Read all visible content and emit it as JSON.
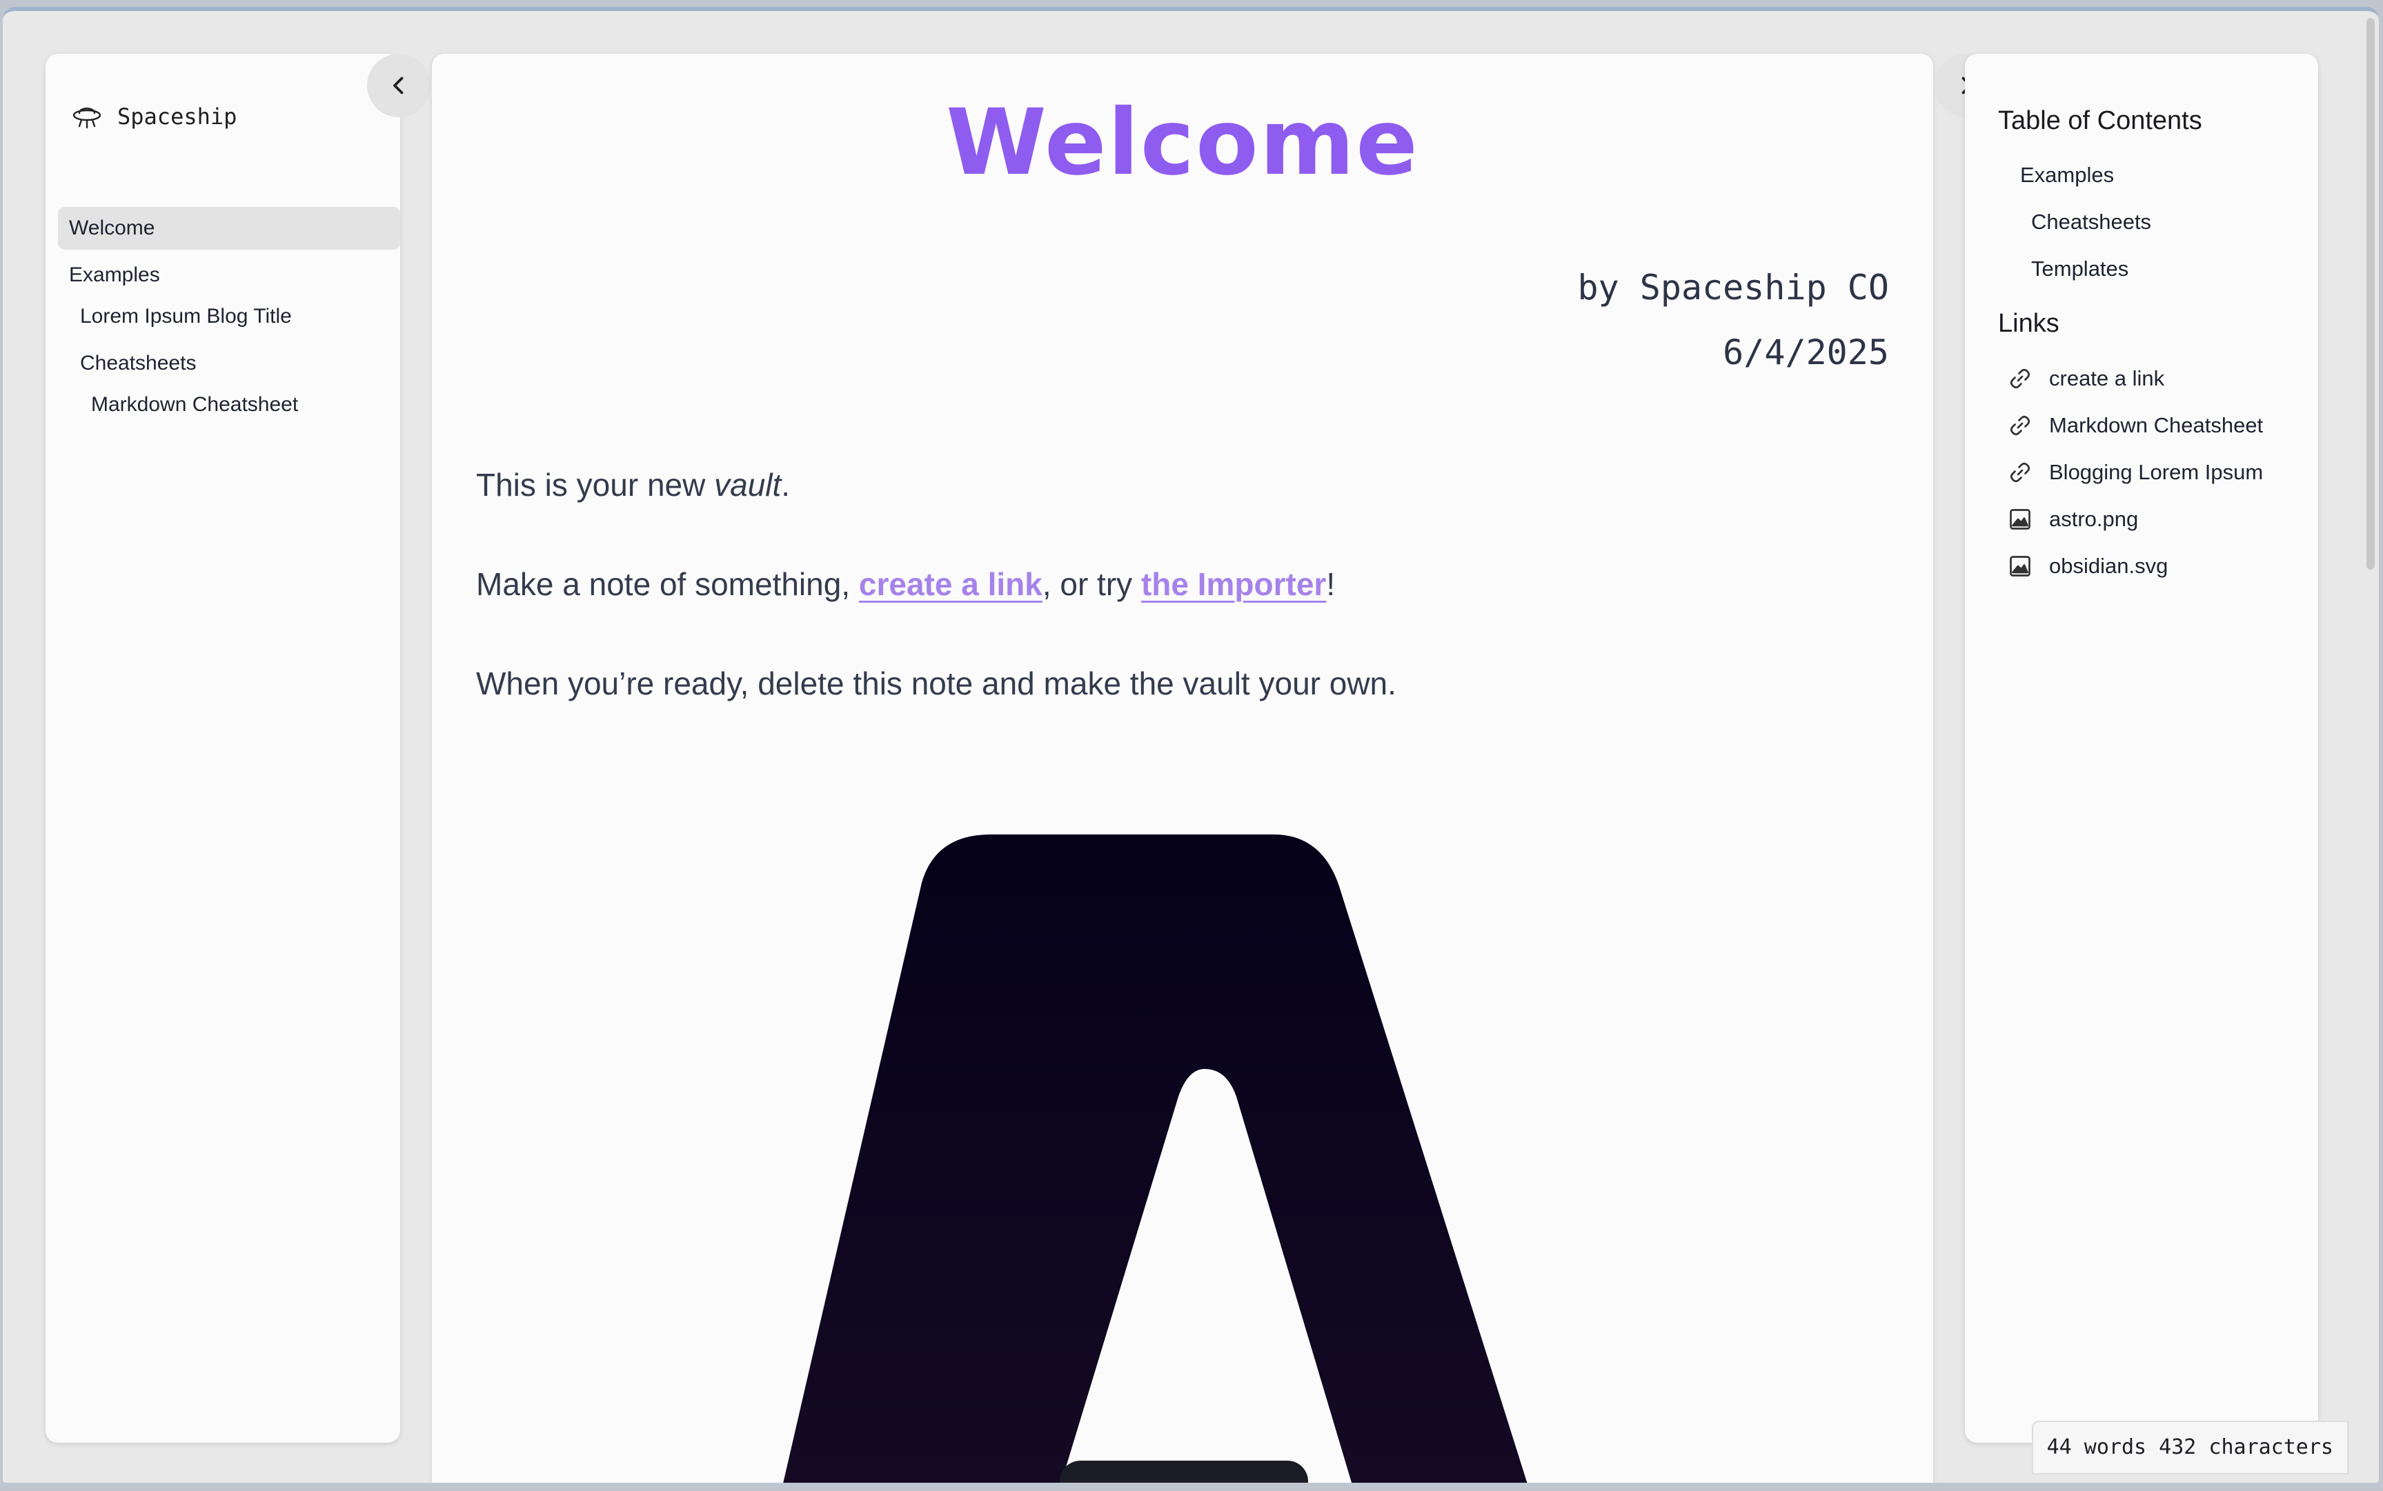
{
  "sidebar": {
    "brand": "Spaceship",
    "items": [
      {
        "label": "Welcome",
        "active": true
      },
      {
        "label": "Examples"
      },
      {
        "label": "Lorem Ipsum Blog Title"
      },
      {
        "label": "Cheatsheets"
      },
      {
        "label": "Markdown Cheatsheet"
      }
    ]
  },
  "note": {
    "title": "Welcome",
    "byline": "by Spaceship CO",
    "date": "6/4/2025",
    "p1_prefix": "This is your new ",
    "p1_em": "vault",
    "p1_suffix": ".",
    "p2_prefix": "Make a note of something, ",
    "p2_link1": "create a link",
    "p2_mid": ", or try ",
    "p2_link2": "the Importer",
    "p2_suffix": "!",
    "p3": "When you’re ready, delete this note and make the vault your own."
  },
  "toc": {
    "title": "Table of Contents",
    "items": [
      "Examples",
      "Cheatsheets",
      "Templates"
    ]
  },
  "links": {
    "title": "Links",
    "items": [
      {
        "label": "create a link",
        "icon": "link-icon"
      },
      {
        "label": "Markdown Cheatsheet",
        "icon": "link-icon"
      },
      {
        "label": "Blogging Lorem Ipsum",
        "icon": "link-icon"
      },
      {
        "label": "astro.png",
        "icon": "image-icon"
      },
      {
        "label": "obsidian.svg",
        "icon": "image-icon"
      }
    ]
  },
  "status": {
    "text": "44 words 432 characters"
  },
  "colors": {
    "accent": "#8f5cf0",
    "link": "#a583ea",
    "hero": "#0a0518"
  }
}
